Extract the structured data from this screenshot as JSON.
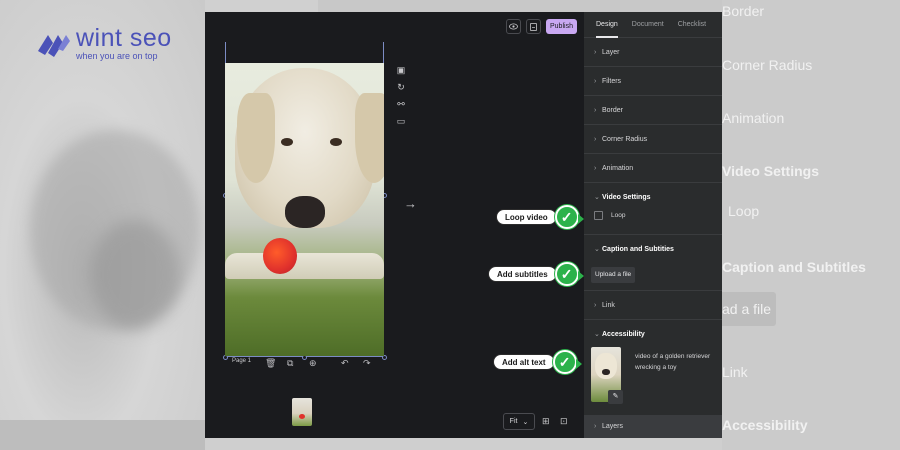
{
  "logo": {
    "title": "wint seo",
    "tagline": "when you are on top"
  },
  "background": {
    "right_items": [
      {
        "text": "Border",
        "bold": false
      },
      {
        "text": "Corner Radius",
        "bold": false
      },
      {
        "text": "Animation",
        "bold": false
      },
      {
        "text": "Video Settings",
        "bold": true
      },
      {
        "text": "Loop",
        "bold": false
      },
      {
        "text": "Caption and Subtitles",
        "bold": true
      },
      {
        "text": "ad a file",
        "bold": false
      },
      {
        "text": "Link",
        "bold": false
      },
      {
        "text": "Accessibility",
        "bold": true
      }
    ]
  },
  "toolbar": {
    "publish_label": "Publish"
  },
  "canvas": {
    "page_label": "Page 1",
    "fit_label": "Fit"
  },
  "callouts": {
    "loop_video": "Loop video",
    "add_subtitles": "Add subtitles",
    "add_alt_text": "Add alt text"
  },
  "panel": {
    "tabs": [
      "Design",
      "Document",
      "Checklist"
    ],
    "sections": {
      "layer": "Layer",
      "filters": "Filters",
      "border": "Border",
      "corner_radius": "Corner Radius",
      "animation": "Animation",
      "video_settings": "Video Settings",
      "loop": "Loop",
      "caption": "Caption and Subtities",
      "upload": "Upload a file",
      "link": "Link",
      "accessibility": "Accessibility",
      "alt_text": "video of a golden retriever wrecking a toy",
      "layers": "Layers"
    }
  },
  "colors": {
    "publish": "#c9a8f2",
    "callout_check": "#2cb24b",
    "logo": "#4b52b8",
    "editor_bg": "#1c1d20",
    "panel_bg": "#2a2c2d"
  }
}
